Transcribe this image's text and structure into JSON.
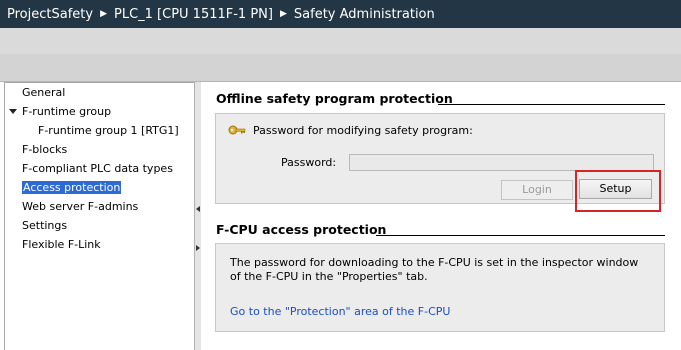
{
  "breadcrumb": {
    "project": "ProjectSafety",
    "device": "PLC_1 [CPU 1511F-1 PN]",
    "page": "Safety Administration"
  },
  "nav": {
    "items": [
      {
        "label": "General"
      },
      {
        "label": "F-runtime group",
        "expanded": true
      },
      {
        "label": "F-runtime group 1 [RTG1]"
      },
      {
        "label": "F-blocks"
      },
      {
        "label": "F-compliant PLC data types"
      },
      {
        "label": "Access protection",
        "selected": true
      },
      {
        "label": "Web server F-admins"
      },
      {
        "label": "Settings"
      },
      {
        "label": "Flexible F-Link"
      }
    ]
  },
  "offline": {
    "title": "Offline safety program protection",
    "password_prompt": "Password for modifying safety program:",
    "password_label": "Password:",
    "password_value": "",
    "login_button": "Login",
    "setup_button": "Setup"
  },
  "fcpu": {
    "title": "F-CPU access protection",
    "description": "The password for downloading to the F-CPU is set in the inspector window of the F-CPU in the \"Properties\" tab.",
    "link": "Go to the \"Protection\" area of the F-CPU"
  },
  "colors": {
    "titlebar": "#233645",
    "selection": "#2d6ad5",
    "link": "#1a4ec2",
    "highlight": "#d42626",
    "key_icon": "#e2b332"
  }
}
